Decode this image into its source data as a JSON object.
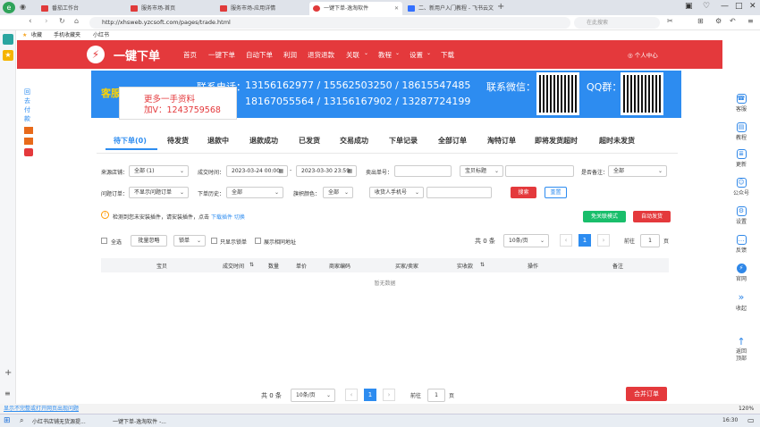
{
  "tabs": [
    {
      "label": "番茄工作台",
      "active": false
    },
    {
      "label": "服务市场-首页",
      "active": false
    },
    {
      "label": "服务市场-应用详情",
      "active": false
    },
    {
      "label": "一键下单-逸淘软件",
      "active": true
    },
    {
      "label": "二、新用户入门教程 - 飞书云文",
      "active": false
    }
  ],
  "browser": {
    "url": "http://xhsweb.yzcsoft.com/pages/trade.html",
    "search_placeholder": "在此搜索",
    "bookmarks": [
      "收藏",
      "手机收藏夹",
      "小红书"
    ]
  },
  "left_sidebar": {
    "label": "回去付款"
  },
  "header": {
    "brand": "一键下单",
    "nav": [
      "首页",
      "一键下单",
      "自动下单",
      "利润",
      "退货退款",
      "关联",
      "教程",
      "设置",
      "下载"
    ],
    "user": "个人中心"
  },
  "banner": {
    "contact_label": "联系电话：",
    "phones_line1": "13156162977 / 15562503250 / 18615547485",
    "phones_line2": "18167055564 / 13156167902 / 13287724199",
    "wechat_label": "联系微信：",
    "qq_label": "QQ群：",
    "service_label": "客服"
  },
  "ad": {
    "line1": "更多一手资料",
    "line2": "加V：1243759568"
  },
  "subtabs": [
    "待下单(0)",
    "待发货",
    "退款中",
    "退款成功",
    "已发货",
    "交易成功",
    "下单记录",
    "全部订单",
    "淘特订单",
    "即将发货超时",
    "超时未发货"
  ],
  "filters": {
    "shop_label": "来源店铺：",
    "shop_value": "全部 (1)",
    "time_label": "成交时间：",
    "time_start": "2023-03-24 00:00",
    "time_end": "2023-03-30 23:59",
    "seller_label": "卖出单号：",
    "goods_tag": "宝贝标题",
    "remark_label": "是否备注：",
    "remark_value": "全部",
    "problem_label": "问题订单：",
    "problem_value": "不显示问题订单",
    "history_label": "下单历史：",
    "history_value": "全部",
    "flag_label": "旗帜颜色：",
    "flag_value": "全部",
    "receiver_value": "收货人手机号",
    "search_btn": "搜索",
    "reset_btn": "重置"
  },
  "notice": {
    "text": "检测到您未安装插件，请安装插件，点击",
    "link": "下载插件",
    "link2": "切换"
  },
  "buttons": {
    "no_login": "免关联模式",
    "auto_order": "自动发货",
    "merge": "合并订单"
  },
  "toolbar": {
    "select_all": "全选",
    "batch_ignore": "批量忽略",
    "lock_label": "锁单",
    "show_lock": "只显示锁单",
    "show_same": "展示相同地址"
  },
  "pagination": {
    "total": "共 0 条",
    "page_size": "10条/页",
    "current": "1",
    "goto_label": "前往",
    "goto_value": "1",
    "page_unit": "页"
  },
  "table": {
    "columns": [
      "宝贝",
      "成交时间",
      "数量",
      "单价",
      "商家编码",
      "买家/卖家",
      "实收款",
      "操作",
      "备注"
    ],
    "empty": "暂无数据"
  },
  "right_sidebar": [
    {
      "label": "客服",
      "icon": "headset-icon"
    },
    {
      "label": "教程",
      "icon": "book-icon"
    },
    {
      "label": "更新",
      "icon": "doc-icon"
    },
    {
      "label": "公众号",
      "icon": "people-icon"
    },
    {
      "label": "设置",
      "icon": "gear-icon"
    },
    {
      "label": "反馈",
      "icon": "chat-icon"
    },
    {
      "label": "官网",
      "icon": "logo-icon"
    },
    {
      "label": "收起",
      "icon": "double-chevron-icon"
    },
    {
      "label": "返回顶部",
      "icon": "arrow-up-icon"
    }
  ],
  "statusbar": {
    "left": "显示不完整或打开网页出现问题",
    "zoom": "120%"
  },
  "taskbar": {
    "items": [
      "小红书店铺无货源提...",
      "一键下单-逸淘软件 -..."
    ],
    "clock": "16:30"
  }
}
